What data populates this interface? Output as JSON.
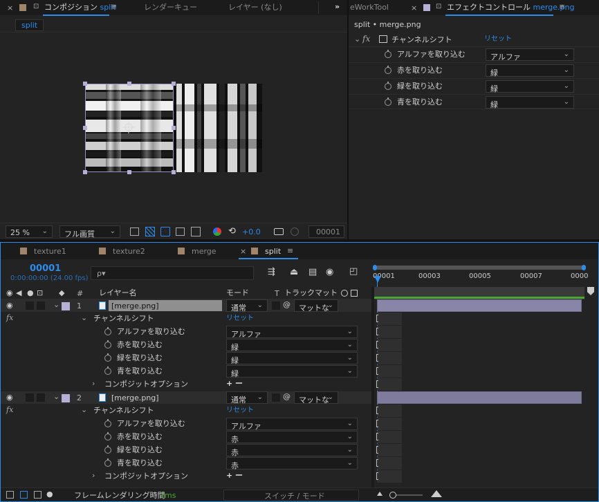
{
  "comp_panel": {
    "tabs": [
      {
        "label": "コンポジション",
        "suffix": "split"
      },
      {
        "label": "レンダーキュー"
      },
      {
        "label": "レイヤー (なし)"
      }
    ],
    "comp_chip": "split",
    "zoom": "25 %",
    "quality": "フル画質",
    "exposure": "+0.0",
    "timecode": "00001"
  },
  "effect_panel": {
    "tab_prev": "eWorkTool",
    "tab_title": "エフェクトコントロール",
    "tab_suffix": "merge.png",
    "path": "split • merge.png",
    "effect_name": "チャンネルシフト",
    "reset": "リセット",
    "props": [
      {
        "label": "アルファを取り込む",
        "value": "アルファ"
      },
      {
        "label": "赤を取り込む",
        "value": "緑"
      },
      {
        "label": "緑を取り込む",
        "value": "緑"
      },
      {
        "label": "青を取り込む",
        "value": "緑"
      }
    ]
  },
  "timeline_tabs": [
    {
      "label": "texture1",
      "color": "#a0856a"
    },
    {
      "label": "texture2",
      "color": "#a0856a"
    },
    {
      "label": "merge",
      "color": "#a0856a"
    },
    {
      "label": "split",
      "color": "#a0856a"
    }
  ],
  "timeline": {
    "timecode": "00001",
    "fps": "0:00:00:00 (24.00 fps)",
    "search_placeholder": "ρ▾",
    "headers": {
      "hash": "#",
      "layer_name": "レイヤー名",
      "mode": "モード",
      "t": "T",
      "trackmatte": "トラックマット"
    },
    "ruler": [
      "00001",
      "00003",
      "00005",
      "00007",
      "0000"
    ],
    "layers": [
      {
        "index": "1",
        "name": "[merge.png]",
        "mode": "通常",
        "matte": "マットな",
        "effect": "チャンネルシフト",
        "reset": "リセット",
        "props": [
          {
            "label": "アルファを取り込む",
            "value": "アルファ"
          },
          {
            "label": "赤を取り込む",
            "value": "緑"
          },
          {
            "label": "緑を取り込む",
            "value": "緑"
          },
          {
            "label": "青を取り込む",
            "value": "緑"
          }
        ],
        "composite": "コンポジットオプション",
        "composite_ctrl": "+ ー"
      },
      {
        "index": "2",
        "name": "[merge.png]",
        "mode": "通常",
        "matte": "マットな",
        "effect": "チャンネルシフト",
        "reset": "リセット",
        "props": [
          {
            "label": "アルファを取り込む",
            "value": "アルファ"
          },
          {
            "label": "赤を取り込む",
            "value": "赤"
          },
          {
            "label": "緑を取り込む",
            "value": "赤"
          },
          {
            "label": "青を取り込む",
            "value": "赤"
          }
        ],
        "composite": "コンポジットオプション",
        "composite_ctrl": "+ ー"
      }
    ],
    "footer": {
      "render_label": "フレームレンダリング時間",
      "render_time": "7ms",
      "switch_mode": "スイッチ / モード"
    }
  },
  "colors": {
    "accent": "#2d8ceb",
    "layer_label": "#b7b0d6",
    "layer_bar": "#7f7b9c",
    "work_area": "#4aa832"
  }
}
